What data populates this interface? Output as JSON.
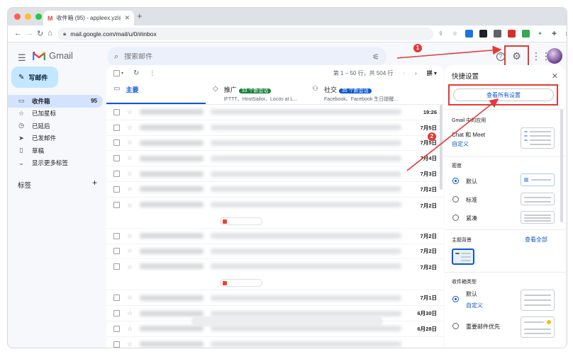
{
  "browser": {
    "tab_title": "收件箱 (95) - appleex.yzl@gm...",
    "tab_close": "✕",
    "new_tab": "+",
    "url": "mail.google.com/mail/u/0/#inbox"
  },
  "header": {
    "app_name": "Gmail",
    "search_placeholder": "搜索邮件",
    "help_glyph": "?",
    "gear_glyph": "⚙",
    "apps_glyph": "⋮⋮"
  },
  "sidebar": {
    "compose_label": "写邮件",
    "items": [
      {
        "label": "收件箱",
        "count": "95",
        "icon": "inbox-icon",
        "glyph": "▭"
      },
      {
        "label": "已加星标",
        "count": "",
        "icon": "star-icon",
        "glyph": "☆"
      },
      {
        "label": "已延后",
        "count": "",
        "icon": "clock-icon",
        "glyph": "◷"
      },
      {
        "label": "已发邮件",
        "count": "",
        "icon": "send-icon",
        "glyph": "➤"
      },
      {
        "label": "草稿",
        "count": "",
        "icon": "draft-icon",
        "glyph": "▯"
      },
      {
        "label": "显示更多标签",
        "count": "",
        "icon": "chevron-down-icon",
        "glyph": "⌄"
      }
    ],
    "labels_title": "标签",
    "labels_add": "+"
  },
  "mail": {
    "page_range": "第 1 – 50 行，共 504 行",
    "sort_label": "拼",
    "tabs": [
      {
        "title": "主要",
        "badge": "",
        "badge_color": "",
        "sub": ""
      },
      {
        "title": "推广",
        "badge": "33 个新会话",
        "badge_color": "#188038",
        "sub": "IFTTT、HostSailor、Locos at L..."
      },
      {
        "title": "社交",
        "badge": "35 个新会话",
        "badge_color": "#0b57d0",
        "sub": "Facebook、Facebook 生日提醒..."
      }
    ],
    "rows": [
      {
        "date": "19:26",
        "tall": false
      },
      {
        "date": "7月5日",
        "tall": false
      },
      {
        "date": "7月5日",
        "tall": false
      },
      {
        "date": "7月4日",
        "tall": false
      },
      {
        "date": "7月3日",
        "tall": false
      },
      {
        "date": "7月2日",
        "tall": false
      },
      {
        "date": "7月2日",
        "tall": true
      },
      {
        "date": "7月2日",
        "tall": false
      },
      {
        "date": "7月2日",
        "tall": false
      },
      {
        "date": "7月2日",
        "tall": true
      },
      {
        "date": "7月1日",
        "tall": false
      },
      {
        "date": "6月30日",
        "tall": false
      },
      {
        "date": "6月28日",
        "tall": false
      },
      {
        "date": "",
        "tall": false
      }
    ]
  },
  "quick_settings": {
    "title": "快捷设置",
    "close_glyph": "✕",
    "see_all_settings": "查看所有设置",
    "gmail_apps_section": "Gmail 中的应用",
    "chat_meet": "Chat 和 Meet",
    "customize": "自定义",
    "density_section": "密度",
    "density_options": [
      "默认",
      "标准",
      "紧凑"
    ],
    "theme_section": "主题背景",
    "theme_see_all": "查看全部",
    "inbox_type_section": "收件箱类型",
    "inbox_default": "默认",
    "inbox_customize": "自定义",
    "important_first": "重要邮件优先"
  },
  "annotations": {
    "step1": "1",
    "step2": "2"
  }
}
